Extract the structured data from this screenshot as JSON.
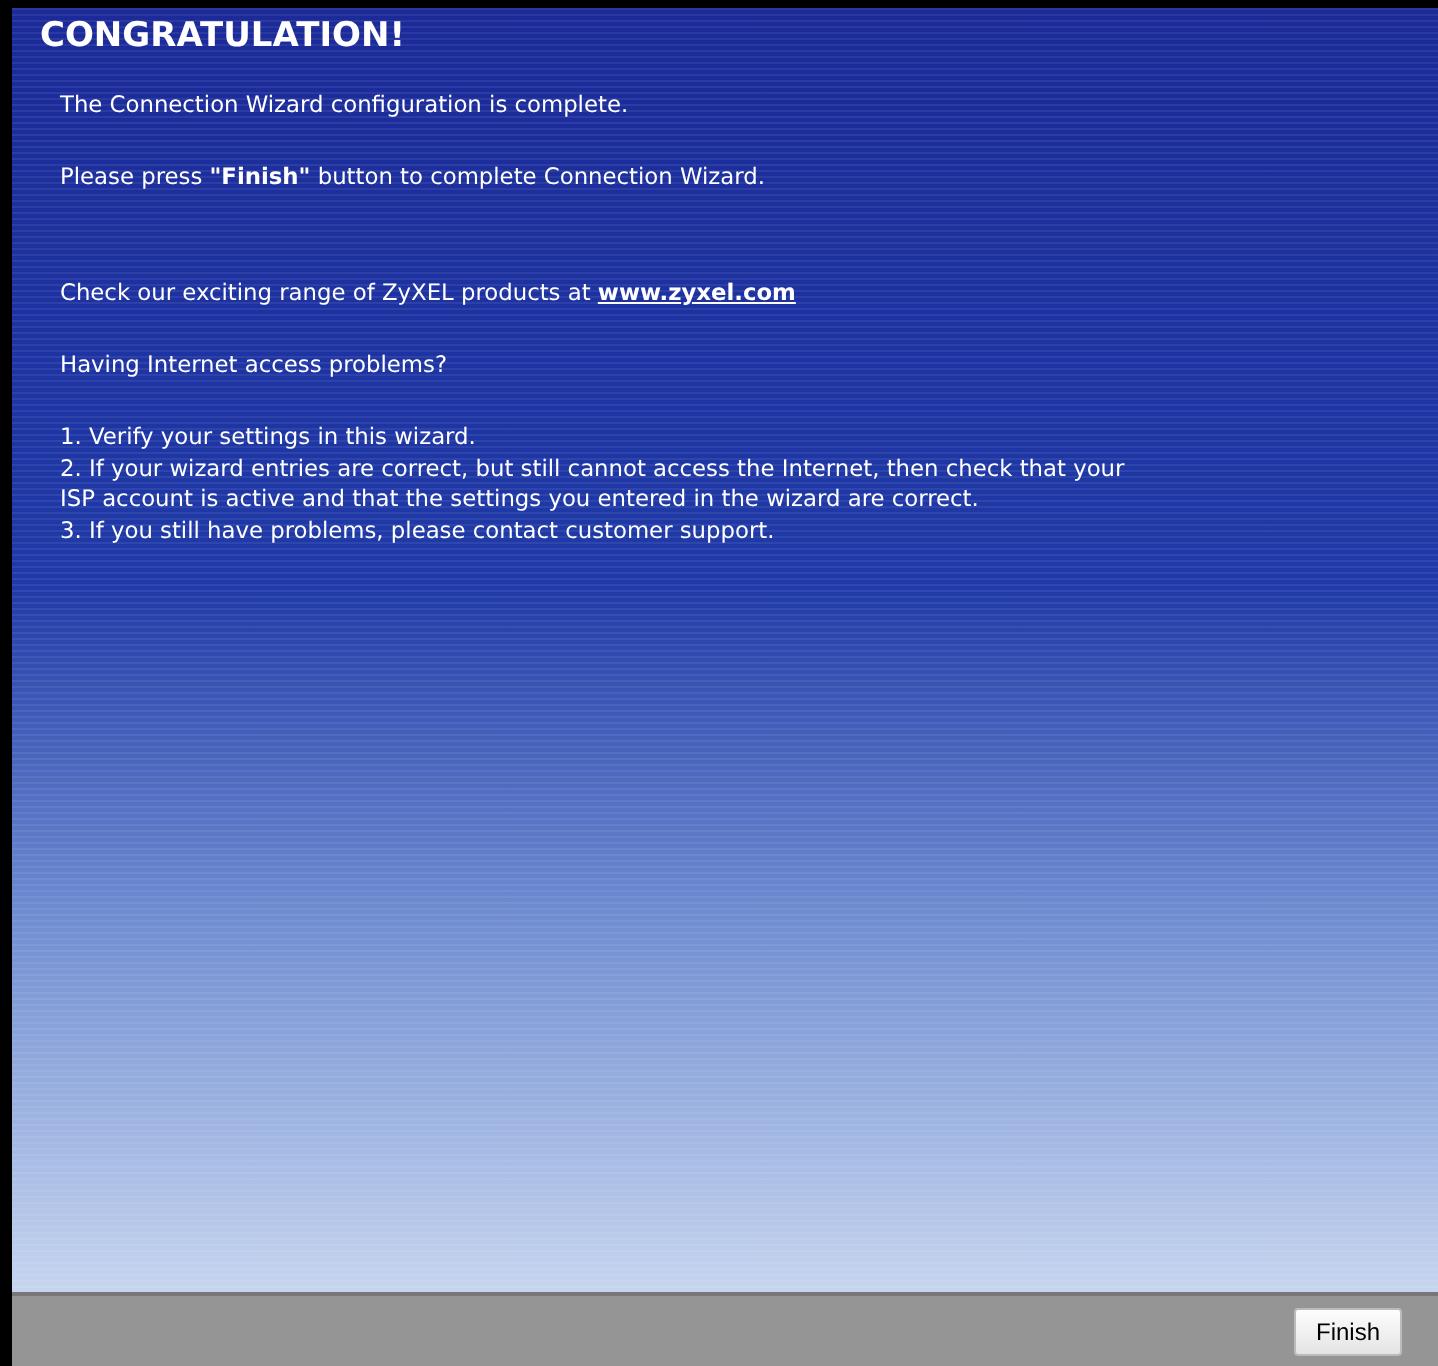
{
  "title": "CONGRATULATION!",
  "message": "The Connection Wizard configuration is complete.",
  "instruction": "Please press **\"Finish\"** button to complete Connection Wizard.",
  "promo": {
    "text": "Check our exciting range of ZyXEL products at",
    "link": "www.zyxel.com"
  },
  "question": "Having Internet access problems?",
  "steps": [
    "1. Verify your settings in this wizard.",
    "2. If your wizard entries are correct, but still cannot access the Internet, then check that your",
    "ISP account is active and that the settings you entered in the wizard are correct.",
    "3. If you still have problems, please contact customer support."
  ],
  "buttons": [
    "Finish"
  ]
}
